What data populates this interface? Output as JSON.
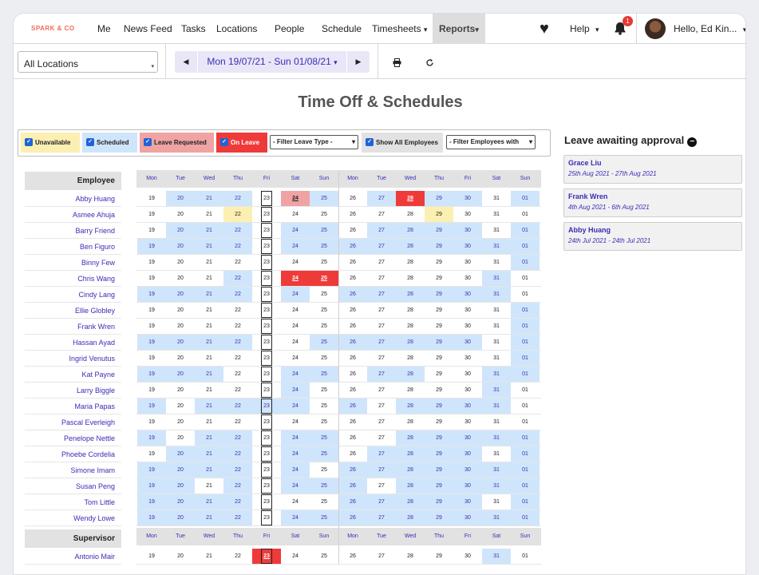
{
  "brand": "SPARK & CO",
  "nav": {
    "items": [
      "Me",
      "News Feed",
      "Tasks",
      "Locations",
      "People",
      "Schedule",
      "Timesheets"
    ],
    "timesheets_caret": "▾",
    "reports": "Reports",
    "reports_caret": "▾",
    "help": "Help",
    "help_caret": "▾",
    "notifications": "1",
    "user": "Hello, Ed Kin...",
    "user_caret": "▾"
  },
  "toolbar": {
    "location": "All Locations",
    "date_range": "Mon 19/07/21 - Sun 01/08/21",
    "date_caret": "▾",
    "prev": "◀",
    "next": "▶",
    "print_icon": "printer-icon",
    "refresh_icon": "refresh-icon"
  },
  "page_title": "Time Off & Schedules",
  "filters": {
    "unavailable": "Unavailable",
    "scheduled": "Scheduled",
    "leave_requested": "Leave Requested",
    "on_leave": "On Leave",
    "leave_type": "- Filter Leave Type -",
    "show_all": "Show All Employees",
    "employees_with": "- Filter Employees with"
  },
  "colors": {
    "scheduled": "#cfe5fb",
    "unavailable": "#fcefb2",
    "leave_requested": "#f0a3a3",
    "on_leave": "#ef3a3a",
    "accent": "#3a2db5"
  },
  "calendar": {
    "days": [
      "Mon",
      "Tue",
      "Wed",
      "Thu",
      "Fri",
      "Sat",
      "Sun",
      "Mon",
      "Tue",
      "Wed",
      "Thu",
      "Fri",
      "Sat",
      "Sun"
    ],
    "dates": [
      "19",
      "20",
      "21",
      "22",
      "23",
      "24",
      "25",
      "26",
      "27",
      "28",
      "29",
      "30",
      "31",
      "01"
    ],
    "employee_header": "Employee",
    "supervisor_header": "Supervisor",
    "employees": [
      {
        "name": "Abby Huang",
        "cells": "-SSS-RS-SLSS-S"
      },
      {
        "name": "Asmee Ahuja",
        "cells": "---U------U---"
      },
      {
        "name": "Barry Friend",
        "cells": "-SSS-SS-SSSS-S"
      },
      {
        "name": "Ben Figuro",
        "cells": "SSSS-SSSSSSSSS"
      },
      {
        "name": "Binny Few",
        "cells": "-------------S"
      },
      {
        "name": "Chris Wang",
        "cells": "---S-LL-----S-"
      },
      {
        "name": "Cindy Lang",
        "cells": "SSSS-S-SSSSSS-"
      },
      {
        "name": "Ellie Globley",
        "cells": "-------------S"
      },
      {
        "name": "Frank Wren",
        "cells": "-------------S"
      },
      {
        "name": "Hassan Ayad",
        "cells": "SSSS--SSSSSS-S"
      },
      {
        "name": "Ingrid Venutus",
        "cells": "-------------S"
      },
      {
        "name": "Kat Payne",
        "cells": "SSS--SS-SS--SS"
      },
      {
        "name": "Larry Biggle",
        "cells": "-----S------S-"
      },
      {
        "name": "Maria Papas",
        "cells": "S-SSSS-S-SSSS-"
      },
      {
        "name": "Pascal Everleigh",
        "cells": "---------------"
      },
      {
        "name": "Penelope Nettle",
        "cells": "S-SS-SS--SSSSS"
      },
      {
        "name": "Phoebe Cordelia",
        "cells": "-SSS-SS-SSSS-S"
      },
      {
        "name": "Simone Imam",
        "cells": "SSSS-S-SSSSSSS"
      },
      {
        "name": "Susan Peng",
        "cells": "SS-S-SSS-SSSSS"
      },
      {
        "name": "Tom Little",
        "cells": "SSSS---SSSSS-S"
      },
      {
        "name": "Wendy Lowe",
        "cells": "SSSS-SSSSSSSSS"
      }
    ],
    "supervisors": [
      {
        "name": "Antonio Mair",
        "cells": "----L-------S-"
      }
    ]
  },
  "leave_panel": {
    "title": "Leave awaiting approval",
    "collapse_icon": "minus-circle-icon",
    "requests": [
      {
        "name": "Grace Liu",
        "dates": "25th Aug 2021 - 27th Aug 2021"
      },
      {
        "name": "Frank Wren",
        "dates": "4th Aug 2021 - 6th Aug 2021"
      },
      {
        "name": "Abby Huang",
        "dates": "24th Jul 2021 - 24th Jul 2021"
      }
    ]
  }
}
